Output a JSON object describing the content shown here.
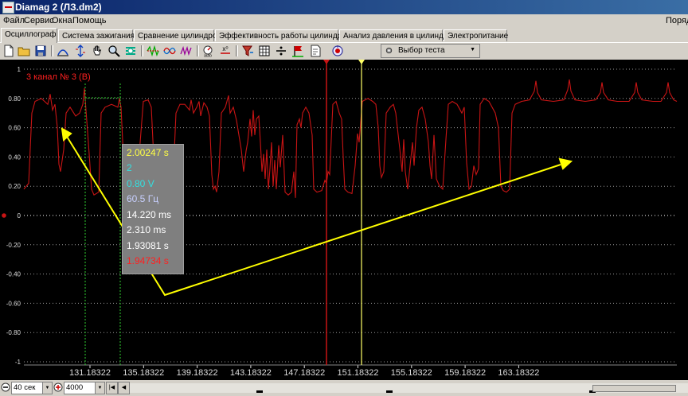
{
  "window": {
    "title": "Diamag 2 (ЛЗ.dm2)",
    "right_menu": "Поряд"
  },
  "menu": [
    "Файл",
    "Сервис",
    "Окна",
    "Помощь"
  ],
  "tabs": [
    {
      "label": "Осциллограф",
      "active": true
    },
    {
      "label": "Система зажигания",
      "active": false
    },
    {
      "label": "Сравнение цилиндров",
      "active": false
    },
    {
      "label": "Эффективность работы цилиндров",
      "active": false
    },
    {
      "label": "Анализ давления в цилиндре",
      "active": false
    },
    {
      "label": "Электропитание",
      "active": false
    }
  ],
  "toolbar": {
    "icons": [
      "new-file-icon",
      "open-folder-icon",
      "save-icon",
      "measure-cursor-icon",
      "scale-cursor-icon",
      "hand-pan-icon",
      "zoom-icon",
      "channel-settings-icon",
      "waveform-1-icon",
      "waveform-2-icon",
      "waveform-3-icon",
      "auto-scale-icon",
      "zero-level-icon",
      "filter-icon",
      "grid-icon",
      "divide-icon",
      "marker-flag-icon",
      "report-icon",
      "record-icon"
    ],
    "auto_label": "auto",
    "zero_label": "x⁰",
    "test_select": "Выбор теста"
  },
  "scope": {
    "channel_label": "3 канал № 3 (В)",
    "yticks": [
      "1",
      "0.80",
      "0.60",
      "0.40",
      "0.20",
      "0",
      "-0.20",
      "-0.40",
      "-0.60",
      "-0.80",
      "-1"
    ],
    "xticks": [
      "131.18322",
      "135.18322",
      "139.18322",
      "143.18322",
      "147.18322",
      "151.18322",
      "155.18322",
      "159.18322",
      "163.18322"
    ],
    "colors": {
      "background": "#000000",
      "trace": "#c81414",
      "cursor_red": "#c81414",
      "cursor_yellow": "#ffff66",
      "annotation_arrow": "#ffff00",
      "cursor_green": "#2fcf2f"
    },
    "measurements": [
      {
        "text": "2.00247 s",
        "color": "#ffff44"
      },
      {
        "text": "2",
        "color": "#33e0e0"
      },
      {
        "text": "0.80 V",
        "color": "#33e0e0"
      },
      {
        "text": "60.5 Гц",
        "color": "#c8d0ff"
      },
      {
        "text": "14.220 ms",
        "color": "#ffffff"
      },
      {
        "text": "2.310 ms",
        "color": "#ffffff"
      },
      {
        "text": "1.93081 s",
        "color": "#ffffff"
      },
      {
        "text": "1.94734 s",
        "color": "#ff2020"
      }
    ]
  },
  "status": {
    "time_window": "40 сек",
    "samples": "4000"
  }
}
